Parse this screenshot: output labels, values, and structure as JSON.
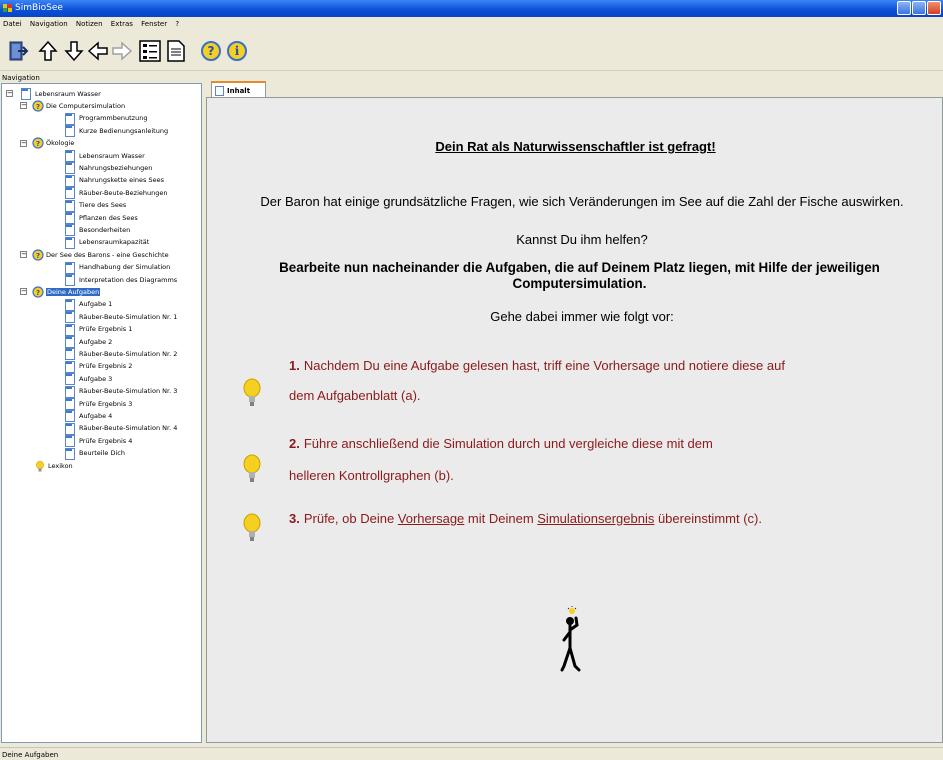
{
  "window": {
    "title": "SimBioSee"
  },
  "menu": [
    "Datei",
    "Navigation",
    "Notizen",
    "Extras",
    "Fenster",
    "?"
  ],
  "toolbar": [
    "exit-icon",
    "up-arrow-icon",
    "down-arrow-icon",
    "back-arrow-icon",
    "forward-arrow-icon",
    "tree-view-icon",
    "document-icon",
    "help-icon",
    "info-icon"
  ],
  "navigation": {
    "label": "Navigation",
    "tree": {
      "root": "Lebensraum Wasser",
      "groups": [
        {
          "label": "Die Computersimulation",
          "items": [
            "Programmbenutzung",
            "Kurze Bedienungsanleitung"
          ]
        },
        {
          "label": "Ökologie",
          "items": [
            "Lebensraum Wasser",
            "Nahrungsbeziehungen",
            "Nahrungskette eines Sees",
            "Räuber-Beute-Beziehungen",
            "Tiere des Sees",
            "Pflanzen des Sees",
            "Besonderheiten",
            "Lebensraumkapazität"
          ]
        },
        {
          "label": "Der See des Barons - eine Geschichte",
          "items": [
            "Handhabung der Simulation",
            "Interpretation des Diagramms"
          ]
        },
        {
          "label": "Deine Aufgaben",
          "items": [
            "Aufgabe 1",
            "Räuber-Beute-Simulation Nr. 1",
            "Prüfe Ergebnis 1",
            "Aufgabe 2",
            "Räuber-Beute-Simulation Nr. 2",
            "Prüfe Ergebnis 2",
            "Aufgabe 3",
            "Räuber-Beute-Simulation Nr. 3",
            "Prüfe Ergebnis 3",
            "Aufgabe 4",
            "Räuber-Beute-Simulation Nr. 4",
            "Prüfe Ergebnis 4",
            "Beurteile Dich"
          ]
        }
      ],
      "last": "Lexikon"
    }
  },
  "tab": {
    "label": "Inhalt"
  },
  "content": {
    "heading": "Dein Rat als Naturwissenschaftler ist gefragt!",
    "para1": "Der Baron hat einige grundsätzliche Fragen, wie sich Veränderungen im See auf die Zahl der Fische auswirken.",
    "para2": "Kannst Du ihm helfen?",
    "para3": "Bearbeite nun nacheinander die Aufgaben, die auf Deinem Platz liegen, mit Hilfe der jeweiligen Computersimulation.",
    "para4": "Gehe dabei immer wie folgt vor:",
    "step1": {
      "num": "1.",
      "line1": "Nachdem Du eine Aufgabe gelesen hast, triff eine Vorhersage und notiere diese auf",
      "line2": "dem Aufgabenblatt (a)."
    },
    "step2": {
      "num": "2.",
      "line1": "Führe anschließend die Simulation durch und vergleiche diese mit dem",
      "line2": "helleren Kontrollgraphen (b)."
    },
    "step3": {
      "num": "3.",
      "pre": "Prüfe, ob Deine ",
      "link1": "Vorhersage",
      "mid": " mit Deinem ",
      "link2": "Simulationsergebnis",
      "post": " übereinstimmt (c)."
    }
  },
  "status": {
    "text": "Deine Aufgaben"
  },
  "colors": {
    "accent_text": "#8b1a1a",
    "selection": "#316ac5",
    "titlebar": "#0a4fd6"
  }
}
